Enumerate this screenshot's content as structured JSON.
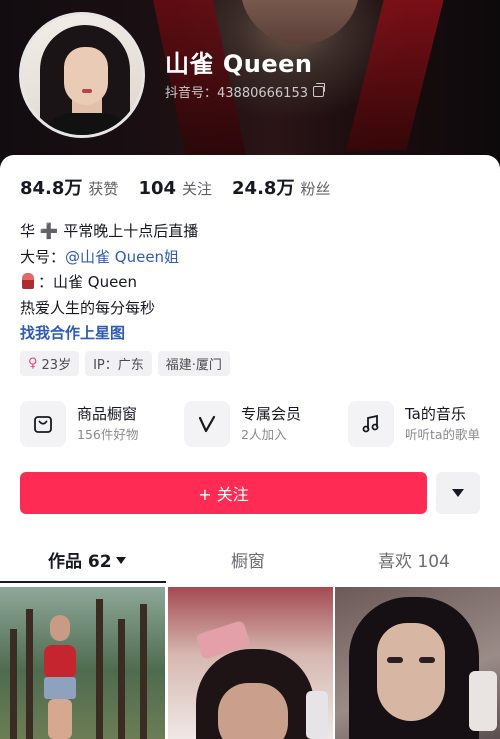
{
  "profile": {
    "name": "山雀 Queen",
    "uid_label": "抖音号：43880666153"
  },
  "stats": [
    {
      "value": "84.8万",
      "label": "获赞"
    },
    {
      "value": "104",
      "label": "关注"
    },
    {
      "value": "24.8万",
      "label": "粉丝"
    }
  ],
  "bio": {
    "line1": "华 ➕ 平常晚上十点后直播",
    "line2_prefix": "大号：",
    "line2_link": "@山雀 Queen姐",
    "line3": "：山雀 Queen",
    "line4": "热爱人生的每分每秒",
    "business_link": "找我合作上星图"
  },
  "tags": {
    "gender_symbol": "♀",
    "age": "23岁",
    "ip": "IP：广东",
    "location": "福建·厦门"
  },
  "services": [
    {
      "title": "商品橱窗",
      "subtitle": "156件好物",
      "icon": "shopping-bag-icon"
    },
    {
      "title": "专属会员",
      "subtitle": "2人加入",
      "icon": "v-member-icon"
    },
    {
      "title": "Ta的音乐",
      "subtitle": "听听ta的歌单",
      "icon": "music-note-icon"
    }
  ],
  "actions": {
    "follow_label": "+ 关注"
  },
  "tabs": [
    {
      "label": "作品 62",
      "active": true
    },
    {
      "label": "橱窗",
      "active": false
    },
    {
      "label": "喜欢 104",
      "active": false
    }
  ],
  "colors": {
    "accent": "#fe2c55",
    "link": "#2d5bb7",
    "text": "#161823"
  }
}
